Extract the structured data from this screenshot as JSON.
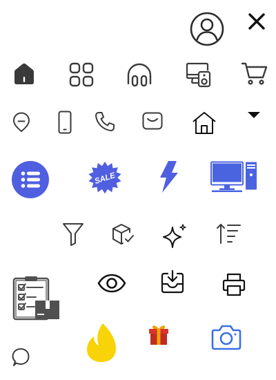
{
  "colors": {
    "dark": "#3a3a3a",
    "black": "#111111",
    "blue": "#4f5fe0",
    "desktop_blue": "#4a64e0",
    "camera_blue": "#3b6fe6",
    "flame_yellow": "#f7d308",
    "gift_red": "#d7342a",
    "gift_gold": "#f1a20b",
    "clipboard_gray": "#505050"
  },
  "icons": [
    "user-avatar-icon",
    "close-icon",
    "home-filled-icon",
    "grid-icon",
    "headphones-icon",
    "devices-speaker-icon",
    "cart-icon",
    "location-pin-icon",
    "mobile-phone-icon",
    "phone-icon",
    "inbox-message-icon",
    "home-outline-icon",
    "dropdown-caret-icon",
    "list-icon",
    "sale-badge-icon",
    "lightning-icon",
    "desktop-computer-icon",
    "filter-icon",
    "package-check-icon",
    "sparkles-icon",
    "sort-ascending-icon",
    "clipboard-checklist-icon",
    "eye-icon",
    "download-tray-icon",
    "printer-icon",
    "flame-icon",
    "gift-icon",
    "camera-icon",
    "chat-bubble-icon"
  ],
  "sale_badge": {
    "label": "SALE"
  }
}
